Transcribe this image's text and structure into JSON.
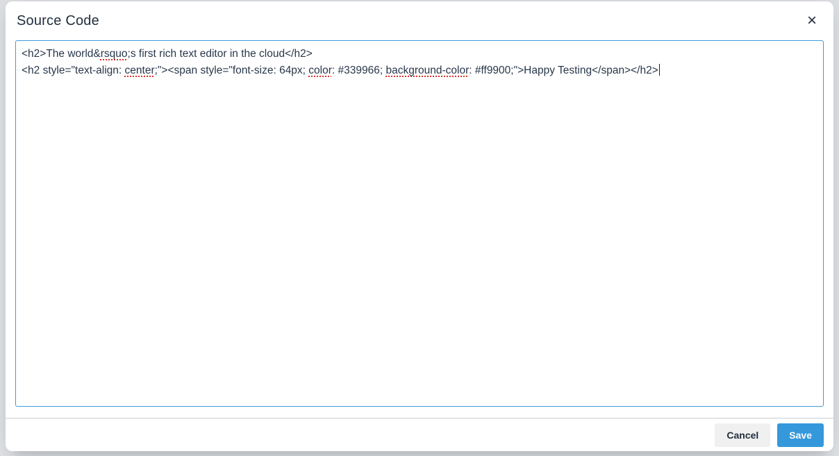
{
  "dialog": {
    "title": "Source Code",
    "close_icon": "×"
  },
  "editor": {
    "value": "<h2>The world&rsquo;s first rich text editor in the cloud</h2>\n<h2 style=\"text-align: center;\"><span style=\"font-size: 64px; color: #339966; background-color: #ff9900;\">Happy Testing</span></h2>",
    "caret_visible": true,
    "lines": [
      [
        {
          "text": "<h2>The world&",
          "misspelled": false
        },
        {
          "text": "rsquo",
          "misspelled": true
        },
        {
          "text": ";s first rich text editor in the cloud</h2>",
          "misspelled": false
        }
      ],
      [
        {
          "text": "<h2 style=\"text-align: ",
          "misspelled": false
        },
        {
          "text": "center",
          "misspelled": true
        },
        {
          "text": ";\"><span style=\"font-size: 64px; ",
          "misspelled": false
        },
        {
          "text": "color",
          "misspelled": true
        },
        {
          "text": ": #339966; ",
          "misspelled": false
        },
        {
          "text": "background-color",
          "misspelled": true
        },
        {
          "text": ": #ff9900;\">Happy Testing</span></h2>",
          "misspelled": false
        }
      ]
    ]
  },
  "footer": {
    "cancel_label": "Cancel",
    "save_label": "Save"
  },
  "colors": {
    "accent_blue": "#3498db",
    "textarea_focus_border": "#3d9ad8",
    "text_dark": "#222f3e",
    "misspell_red": "#d93025",
    "footer_divider": "#c9cccf",
    "secondary_button_bg": "#f0f0f0"
  }
}
